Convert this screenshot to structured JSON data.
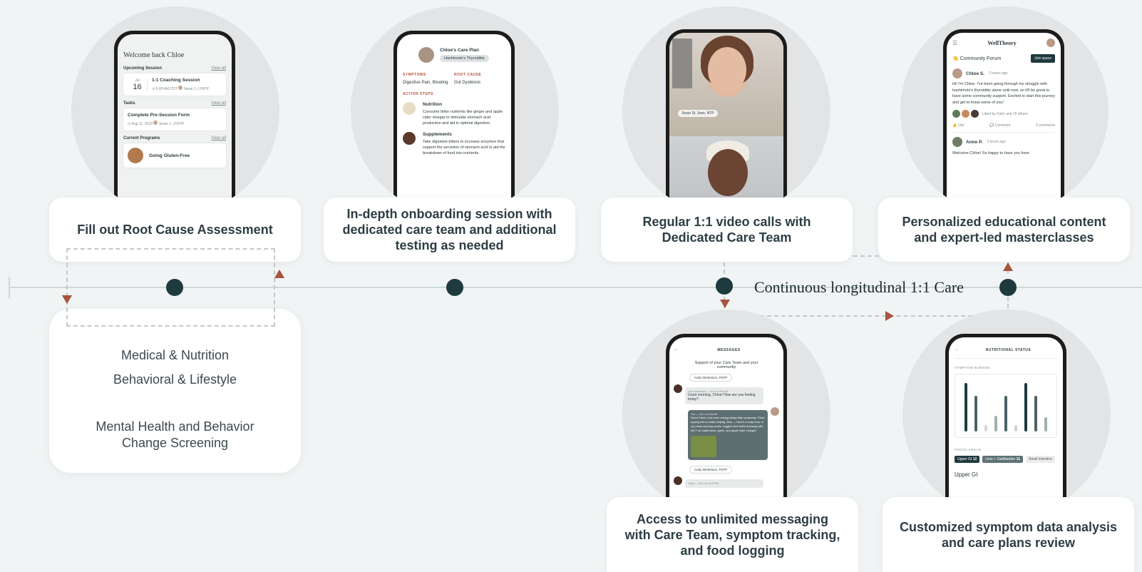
{
  "colors": {
    "background": "#f1f4f4",
    "node": "#1e3a3f",
    "arrow": "#a8533f",
    "dashed": "#c3c8c8"
  },
  "timeline": {
    "continuous_label": "Continuous longitudinal 1:1 Care"
  },
  "steps": {
    "assessment": {
      "label": "Fill out Root Cause Assessment"
    },
    "onboarding": {
      "label": "In-depth onboarding session with dedicated care team and additional testing as needed"
    },
    "video": {
      "label": "Regular 1:1 video calls with Dedicated Care Team"
    },
    "education": {
      "label": "Personalized educational content and expert-led masterclasses"
    },
    "messaging": {
      "label": "Access to unlimited messaging with Care Team, symptom tracking, and food logging"
    },
    "analysis": {
      "label": "Customized symptom data analysis and care plans review"
    }
  },
  "screening": {
    "line1": "Medical & Nutrition",
    "line2": "Behavioral & Lifestyle",
    "line3": "Mental Health and Behavior Change Screening"
  },
  "phone_home": {
    "welcome": "Welcome back Chloe",
    "upcoming": "Upcoming Session",
    "view_all": "View all",
    "month": "Jul",
    "day": "16",
    "session_title": "1-1 Coaching Session",
    "session_meta": "9:00 AM CDT",
    "coach": "Jesse J. | FNTP",
    "tasks": "Tasks",
    "task_title": "Complete Pre-Session Form",
    "task_date": "Aug 11, 2023",
    "programs": "Current Programs",
    "program_name": "Going Gluten-Free"
  },
  "phone_plan": {
    "title": "Chloe's Care Plan",
    "condition": "Hashimoto's Thyroiditis",
    "symptoms_label": "SYMPTOMS",
    "root_label": "ROOT CAUSE",
    "symptoms": "Digestive Pain, Bloating",
    "root": "Gut Dysbiosis",
    "actions_label": "ACTION STEPS",
    "step1_title": "Nutrition",
    "step1_text": "Consume bitter nutrients like ginger and apple cider vinegar to stimulate stomach acid production and aid in optimal digestion.",
    "step2_title": "Supplements",
    "step2_text": "Take digestive bitters to increase enzymes that support the secretion of stomach acid to aid the breakdown of food into nutrients."
  },
  "phone_video": {
    "name_tag": "Jesse St. Jean, NTP"
  },
  "phone_forum": {
    "brand": "WellTheory",
    "forum": "Community Forum",
    "join": "Join space",
    "poster": "Chloe S.",
    "posted": "2 hours ago",
    "post": "Hi! I'm Chloe. I've been going through my struggle with hashimoto's thyroiditis alone until now, so it'll be great to have some community support. Excited to start this journey and get to know some of you!",
    "liked": "Liked by Carly and 16 others",
    "like": "Like",
    "comment": "Comment",
    "comments": "3 comments",
    "reply_name": "Anne P.",
    "reply_time": "2 hours ago",
    "reply": "Welcome Chloe! So happy to have you here."
  },
  "phone_messages": {
    "title": "MESSAGES",
    "subtitle": "Support of your Care Team and your community",
    "chip1": "Carly Michelson, FNTP",
    "msg1_meta": "Carly Michelson — Oct 1 at 9:00 AM",
    "msg1": "Good morning, Chloe! How are you feeling today?",
    "msg2_meta": "You — Oct 1 at 9:05 AM",
    "msg2": "Good! Have a lot more energy today than yesterday. Think upping fats is really helping. Also — here's a snap from of my most-morning snack: veggies and tahini dressing with MCT oil, watercress, garlic, and apple cider vinegar!",
    "chip2": "Carly Michelson, FNTP",
    "msg3_meta": "Jesse — Oct 1 at 10:05 PM"
  },
  "phone_status": {
    "title": "NUTRITIONAL STATUS",
    "burden": "SYMPTOM BURDEN",
    "focus": "FOCUS AREAS",
    "area1": "Upper GI",
    "area1_score": "12",
    "area2": "Liver + Gallbladder",
    "area2_score": "11",
    "area3": "Small Intestine",
    "selected": "Upper GI",
    "bars": [
      0.95,
      0.7,
      0.12,
      0.3,
      0.7,
      0.12,
      0.95,
      0.7,
      0.28
    ],
    "bar_colors": [
      "#1e3a3f",
      "#4d6266",
      "#d0d6d6",
      "#9fb0b0",
      "#4d6266",
      "#d0d6d6",
      "#1e3a3f",
      "#4d6266",
      "#9fb0b0"
    ]
  }
}
